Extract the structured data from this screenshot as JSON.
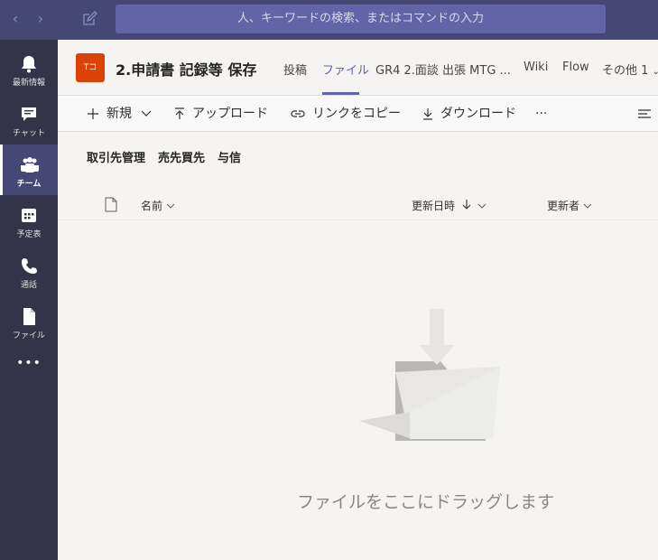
{
  "search": {
    "placeholder": "人、キーワードの検索、またはコマンドの入力"
  },
  "rail": {
    "items": [
      {
        "label": "最新情報",
        "icon": "bell-icon"
      },
      {
        "label": "チャット",
        "icon": "chat-icon"
      },
      {
        "label": "チーム",
        "icon": "teams-icon",
        "active": true
      },
      {
        "label": "予定表",
        "icon": "calendar-icon"
      },
      {
        "label": "通話",
        "icon": "phone-icon"
      },
      {
        "label": "ファイル",
        "icon": "file-icon"
      }
    ],
    "more": "•••"
  },
  "header": {
    "avatar_text": "Tコ",
    "title": "2.申請書 記録等 保存",
    "tabs": [
      {
        "label": "投稿"
      },
      {
        "label": "ファイル",
        "active": true
      },
      {
        "label": "GR4 2.面談 出張 MTG ..."
      },
      {
        "label": "Wiki"
      },
      {
        "label": "Flow"
      },
      {
        "label": "その他 1"
      }
    ]
  },
  "toolbar": {
    "new_label": "新規",
    "upload_label": "アップロード",
    "copy_link_label": "リンクをコピー",
    "download_label": "ダウンロード",
    "more_label": "···"
  },
  "breadcrumb": [
    "取引先管理",
    "売先買先",
    "与信"
  ],
  "columns": {
    "name": "名前",
    "modified": "更新日時",
    "modified_by": "更新者"
  },
  "empty_state": {
    "text": "ファイルをここにドラッグします"
  },
  "colors": {
    "accent": "#6264a7",
    "topbar": "#464775",
    "rail": "#33344a",
    "avatar": "#dc4108"
  }
}
